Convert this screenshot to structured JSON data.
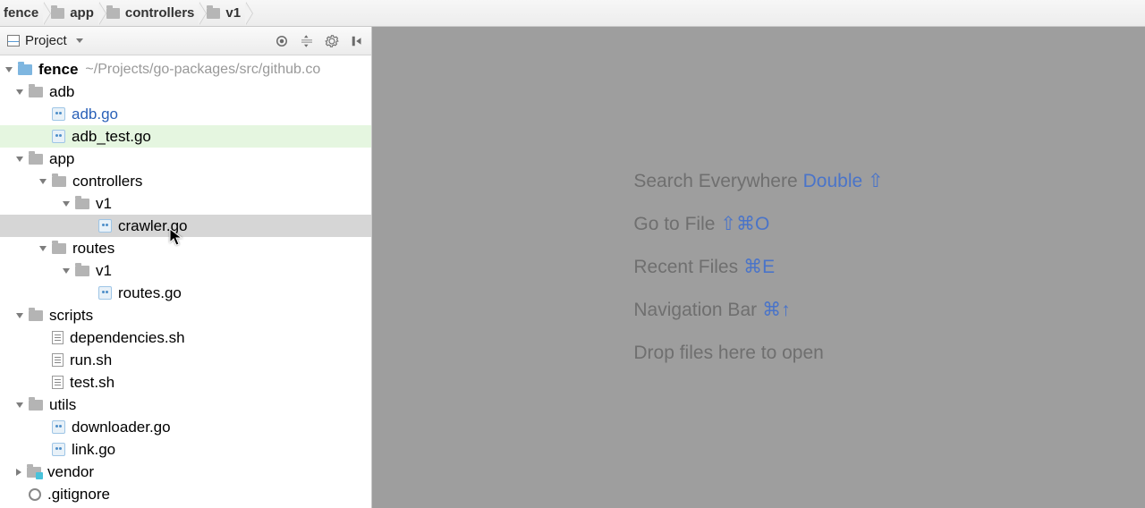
{
  "breadcrumb": {
    "items": [
      "fence",
      "app",
      "controllers",
      "v1"
    ]
  },
  "sidebar": {
    "title": "Project"
  },
  "project": {
    "name": "fence",
    "path": "~/Projects/go-packages/src/github.co"
  },
  "tree": [
    {
      "name": "adb",
      "type": "folder",
      "depth": 1,
      "open": true
    },
    {
      "name": "adb.go",
      "type": "go",
      "depth": 2,
      "blue": true
    },
    {
      "name": "adb_test.go",
      "type": "go",
      "depth": 2,
      "highlight": true
    },
    {
      "name": "app",
      "type": "folder",
      "depth": 1,
      "open": true
    },
    {
      "name": "controllers",
      "type": "folder",
      "depth": 2,
      "open": true
    },
    {
      "name": "v1",
      "type": "folder",
      "depth": 3,
      "open": true
    },
    {
      "name": "crawler.go",
      "type": "go",
      "depth": 4,
      "selected": true
    },
    {
      "name": "routes",
      "type": "folder",
      "depth": 2,
      "open": true
    },
    {
      "name": "v1",
      "type": "folder",
      "depth": 3,
      "open": true
    },
    {
      "name": "routes.go",
      "type": "go",
      "depth": 4
    },
    {
      "name": "scripts",
      "type": "folder",
      "depth": 1,
      "open": true
    },
    {
      "name": "dependencies.sh",
      "type": "sh",
      "depth": 2
    },
    {
      "name": "run.sh",
      "type": "sh",
      "depth": 2
    },
    {
      "name": "test.sh",
      "type": "sh",
      "depth": 2
    },
    {
      "name": "utils",
      "type": "folder",
      "depth": 1,
      "open": true
    },
    {
      "name": "downloader.go",
      "type": "go",
      "depth": 2
    },
    {
      "name": "link.go",
      "type": "go",
      "depth": 2
    },
    {
      "name": "vendor",
      "type": "folder-teal",
      "depth": 1,
      "open": false
    },
    {
      "name": ".gitignore",
      "type": "git",
      "depth": 1
    }
  ],
  "welcome": {
    "l1": "Search Everywhere",
    "s1": "Double ⇧",
    "l2": "Go to File",
    "s2": "⇧⌘O",
    "l3": "Recent Files",
    "s3": "⌘E",
    "l4": "Navigation Bar",
    "s4": "⌘↑",
    "l5": "Drop files here to open"
  }
}
